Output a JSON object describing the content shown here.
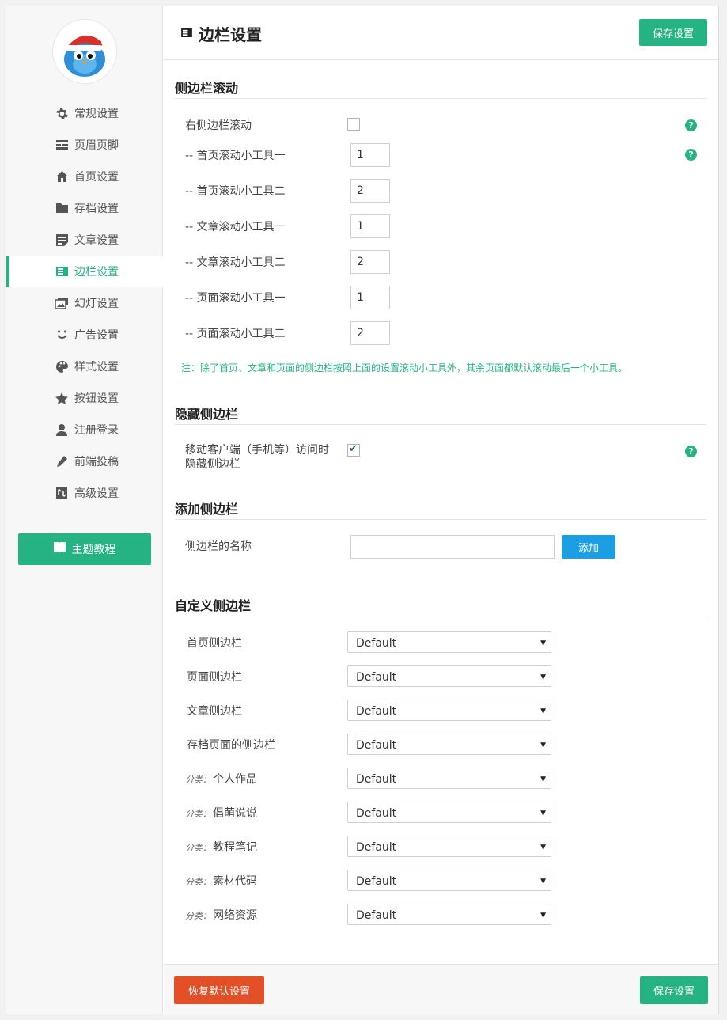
{
  "sidebar": {
    "items": [
      {
        "label": "常规设置",
        "icon": "gear-icon"
      },
      {
        "label": "页眉页脚",
        "icon": "header-footer-icon"
      },
      {
        "label": "首页设置",
        "icon": "home-icon"
      },
      {
        "label": "存档设置",
        "icon": "folder-icon"
      },
      {
        "label": "文章设置",
        "icon": "article-icon"
      },
      {
        "label": "边栏设置",
        "icon": "sidebar-icon"
      },
      {
        "label": "幻灯设置",
        "icon": "slides-icon"
      },
      {
        "label": "广告设置",
        "icon": "smile-icon"
      },
      {
        "label": "样式设置",
        "icon": "palette-icon"
      },
      {
        "label": "按钮设置",
        "icon": "star-icon"
      },
      {
        "label": "注册登录",
        "icon": "user-icon"
      },
      {
        "label": "前端投稿",
        "icon": "pencil-icon"
      },
      {
        "label": "高级设置",
        "icon": "advanced-icon"
      }
    ],
    "active_index": 5,
    "tutorial_label": "主题教程"
  },
  "header": {
    "title": "边栏设置",
    "save_label": "保存设置"
  },
  "scroll_section": {
    "title": "侧边栏滚动",
    "right_scroll_label": "右侧边栏滚动",
    "right_scroll_checked": false,
    "widgets": [
      {
        "label": "-- 首页滚动小工具一",
        "value": "1"
      },
      {
        "label": "-- 首页滚动小工具二",
        "value": "2"
      },
      {
        "label": "-- 文章滚动小工具一",
        "value": "1"
      },
      {
        "label": "-- 文章滚动小工具二",
        "value": "2"
      },
      {
        "label": "-- 页面滚动小工具一",
        "value": "1"
      },
      {
        "label": "-- 页面滚动小工具二",
        "value": "2"
      }
    ],
    "note": "注：除了首页、文章和页面的侧边栏按照上面的设置滚动小工具外，其余页面都默认滚动最后一个小工具。"
  },
  "hide_section": {
    "title": "隐藏侧边栏",
    "mobile_label_line1": "移动客户端（手机等）访问时",
    "mobile_label_line2": "隐藏侧边栏",
    "mobile_checked": true
  },
  "add_section": {
    "title": "添加侧边栏",
    "name_label": "侧边栏的名称",
    "name_value": "",
    "add_label": "添加"
  },
  "custom_section": {
    "title": "自定义侧边栏",
    "rows": [
      {
        "prefix": "",
        "label": "首页侧边栏",
        "value": "Default"
      },
      {
        "prefix": "",
        "label": "页面侧边栏",
        "value": "Default"
      },
      {
        "prefix": "",
        "label": "文章侧边栏",
        "value": "Default"
      },
      {
        "prefix": "",
        "label": "存档页面的侧边栏",
        "value": "Default"
      },
      {
        "prefix": "分类：",
        "label": "个人作品",
        "value": "Default"
      },
      {
        "prefix": "分类：",
        "label": "倡萌说说",
        "value": "Default"
      },
      {
        "prefix": "分类：",
        "label": "教程笔记",
        "value": "Default"
      },
      {
        "prefix": "分类：",
        "label": "素材代码",
        "value": "Default"
      },
      {
        "prefix": "分类：",
        "label": "网络资源",
        "value": "Default"
      }
    ]
  },
  "footer": {
    "reset_label": "恢复默认设置",
    "save_label": "保存设置"
  },
  "colors": {
    "accent": "#26b383",
    "danger": "#e34f26",
    "link_blue": "#1c9ee3"
  }
}
